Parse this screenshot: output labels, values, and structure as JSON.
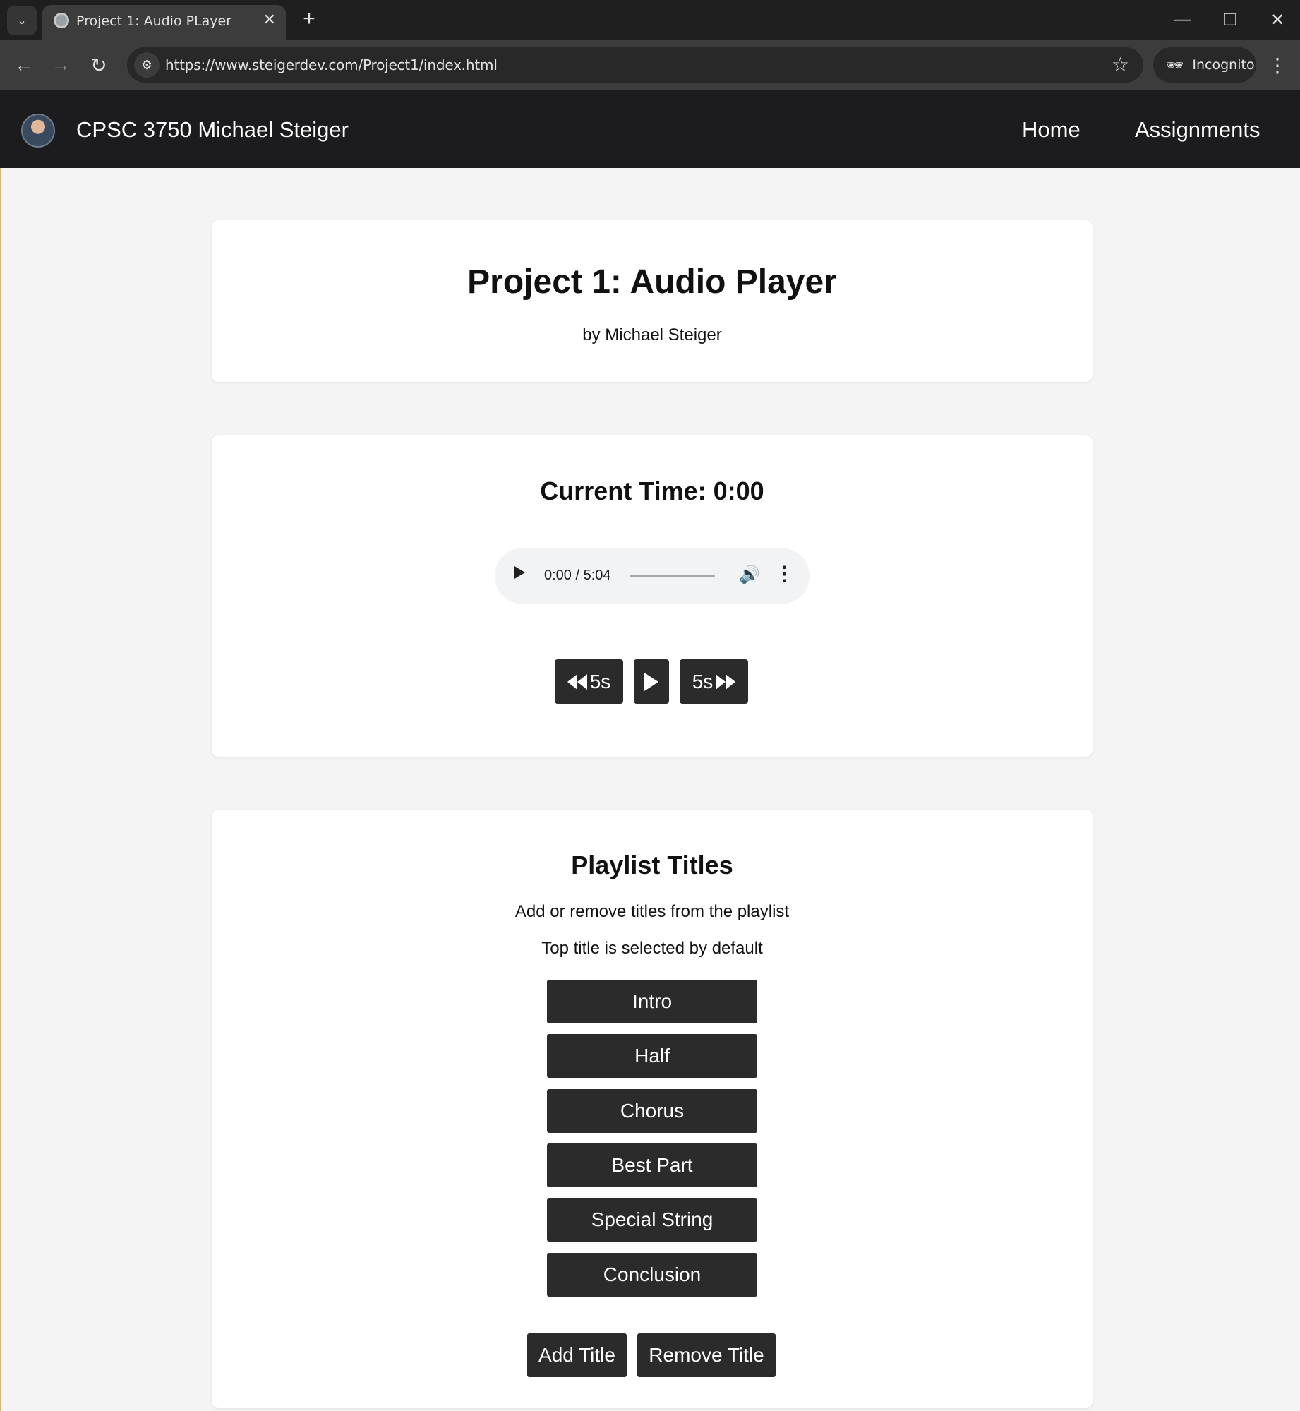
{
  "browser": {
    "tab_title": "Project 1: Audio PLayer",
    "url": "https://www.steigerdev.com/Project1/index.html",
    "incognito_label": "Incognito"
  },
  "site": {
    "title": "CPSC 3750 Michael Steiger",
    "nav": [
      "Home",
      "Assignments"
    ]
  },
  "header_card": {
    "title": "Project 1: Audio Player",
    "byline": "by Michael Steiger"
  },
  "player_card": {
    "current_time_label": "Current Time: 0:00",
    "audio_time": "0:00 / 5:04",
    "rewind_label": "5s",
    "forward_label": "5s",
    "progress_fraction": 0.0
  },
  "playlist_card": {
    "title": "Playlist Titles",
    "line1": "Add or remove titles from the playlist",
    "line2": "Top title is selected by default",
    "items": [
      "Intro",
      "Half",
      "Chorus",
      "Best Part",
      "Special String",
      "Conclusion"
    ],
    "add_label": "Add Title",
    "remove_label": "Remove Title"
  }
}
